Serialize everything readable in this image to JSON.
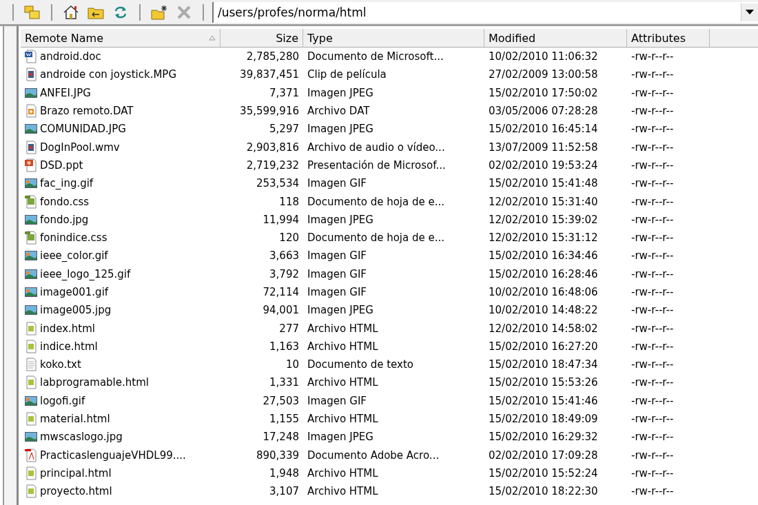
{
  "toolbar": {
    "buttons": [
      {
        "kind": "folders",
        "disabled": false
      },
      {
        "kind": "separator"
      },
      {
        "kind": "home",
        "disabled": false
      },
      {
        "kind": "up",
        "disabled": false
      },
      {
        "kind": "refresh",
        "disabled": false
      },
      {
        "kind": "separator"
      },
      {
        "kind": "newfolder",
        "disabled": false
      },
      {
        "kind": "delete",
        "disabled": true
      },
      {
        "kind": "separator"
      }
    ],
    "path": "/users/profes/norma/html"
  },
  "table": {
    "columns": [
      {
        "label": "Remote Name",
        "sorted": true
      },
      {
        "label": "Size",
        "sorted": false
      },
      {
        "label": "Type",
        "sorted": false
      },
      {
        "label": "Modified",
        "sorted": false
      },
      {
        "label": "Attributes",
        "sorted": false
      }
    ],
    "rows": [
      {
        "kind": "word",
        "name": "android.doc",
        "size": "2,785,280",
        "type": "Documento de Microsoft...",
        "modified": "10/02/2010 11:06:32",
        "attributes": "-rw-r--r--"
      },
      {
        "kind": "video",
        "name": "androide con joystick.MPG",
        "size": "39,837,451",
        "type": "Clip de película",
        "modified": "27/02/2009 13:00:58",
        "attributes": "-rw-r--r--"
      },
      {
        "kind": "image",
        "name": "ANFEI.JPG",
        "size": "7,371",
        "type": "Imagen JPEG",
        "modified": "15/02/2010 17:50:02",
        "attributes": "-rw-r--r--"
      },
      {
        "kind": "media",
        "name": "Brazo remoto.DAT",
        "size": "35,599,916",
        "type": "Archivo DAT",
        "modified": "03/05/2006 07:28:28",
        "attributes": "-rw-r--r--"
      },
      {
        "kind": "image",
        "name": "COMUNIDAD.JPG",
        "size": "5,297",
        "type": "Imagen JPEG",
        "modified": "15/02/2010 16:45:14",
        "attributes": "-rw-r--r--"
      },
      {
        "kind": "video",
        "name": "DogInPool.wmv",
        "size": "2,903,816",
        "type": "Archivo de audio o vídeo...",
        "modified": "13/07/2009 11:52:58",
        "attributes": "-rw-r--r--"
      },
      {
        "kind": "ppt",
        "name": "DSD.ppt",
        "size": "2,719,232",
        "type": "Presentación de Microsof...",
        "modified": "02/02/2010 19:53:24",
        "attributes": "-rw-r--r--"
      },
      {
        "kind": "gif",
        "name": "fac_ing.gif",
        "size": "253,534",
        "type": "Imagen GIF",
        "modified": "15/02/2010 15:41:48",
        "attributes": "-rw-r--r--"
      },
      {
        "kind": "css",
        "name": "fondo.css",
        "size": "118",
        "type": "Documento de hoja de e...",
        "modified": "12/02/2010 15:31:40",
        "attributes": "-rw-r--r--"
      },
      {
        "kind": "image",
        "name": "fondo.jpg",
        "size": "11,994",
        "type": "Imagen JPEG",
        "modified": "12/02/2010 15:39:02",
        "attributes": "-rw-r--r--"
      },
      {
        "kind": "css",
        "name": "fonindice.css",
        "size": "120",
        "type": "Documento de hoja de e...",
        "modified": "12/02/2010 15:31:12",
        "attributes": "-rw-r--r--"
      },
      {
        "kind": "gif",
        "name": "ieee_color.gif",
        "size": "3,663",
        "type": "Imagen GIF",
        "modified": "15/02/2010 16:34:46",
        "attributes": "-rw-r--r--"
      },
      {
        "kind": "gif",
        "name": "ieee_logo_125.gif",
        "size": "3,792",
        "type": "Imagen GIF",
        "modified": "15/02/2010 16:28:46",
        "attributes": "-rw-r--r--"
      },
      {
        "kind": "gif",
        "name": "image001.gif",
        "size": "72,114",
        "type": "Imagen GIF",
        "modified": "10/02/2010 16:48:06",
        "attributes": "-rw-r--r--"
      },
      {
        "kind": "image",
        "name": "image005.jpg",
        "size": "94,001",
        "type": "Imagen JPEG",
        "modified": "10/02/2010 14:48:22",
        "attributes": "-rw-r--r--"
      },
      {
        "kind": "html",
        "name": "index.html",
        "size": "277",
        "type": "Archivo HTML",
        "modified": "12/02/2010 14:58:02",
        "attributes": "-rw-r--r--"
      },
      {
        "kind": "html",
        "name": "indice.html",
        "size": "1,163",
        "type": "Archivo HTML",
        "modified": "15/02/2010 16:27:20",
        "attributes": "-rw-r--r--"
      },
      {
        "kind": "text",
        "name": "koko.txt",
        "size": "10",
        "type": "Documento de texto",
        "modified": "15/02/2010 18:47:34",
        "attributes": "-rw-r--r--"
      },
      {
        "kind": "html",
        "name": "labprogramable.html",
        "size": "1,331",
        "type": "Archivo HTML",
        "modified": "15/02/2010 15:53:26",
        "attributes": "-rw-r--r--"
      },
      {
        "kind": "gif",
        "name": "logofi.gif",
        "size": "27,503",
        "type": "Imagen GIF",
        "modified": "15/02/2010 15:41:46",
        "attributes": "-rw-r--r--"
      },
      {
        "kind": "html",
        "name": "material.html",
        "size": "1,155",
        "type": "Archivo HTML",
        "modified": "15/02/2010 18:49:09",
        "attributes": "-rw-r--r--"
      },
      {
        "kind": "image",
        "name": "mwscaslogo.jpg",
        "size": "17,248",
        "type": "Imagen JPEG",
        "modified": "15/02/2010 16:29:32",
        "attributes": "-rw-r--r--"
      },
      {
        "kind": "pdf",
        "name": "PracticaslenguajeVHDL99....",
        "size": "890,339",
        "type": "Documento Adobe Acro...",
        "modified": "02/02/2010 17:09:28",
        "attributes": "-rw-r--r--"
      },
      {
        "kind": "html",
        "name": "principal.html",
        "size": "1,948",
        "type": "Archivo HTML",
        "modified": "15/02/2010 15:52:24",
        "attributes": "-rw-r--r--"
      },
      {
        "kind": "html",
        "name": "proyecto.html",
        "size": "3,107",
        "type": "Archivo HTML",
        "modified": "15/02/2010 18:22:30",
        "attributes": "-rw-r--r--"
      }
    ]
  }
}
